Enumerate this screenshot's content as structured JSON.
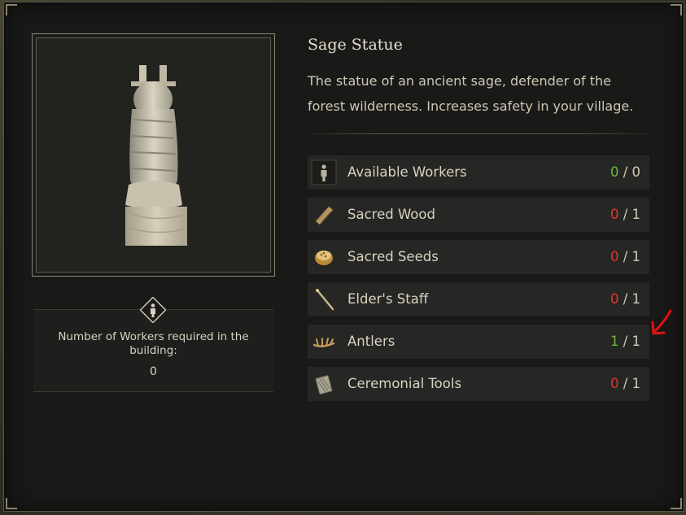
{
  "building": {
    "title": "Sage Statue",
    "description": "The statue of an ancient sage, defender of the forest wilderness. Increases safety in your village."
  },
  "workers_panel": {
    "label": "Number of Workers required in the building:",
    "value": "0",
    "icon": "worker-icon"
  },
  "resources": [
    {
      "name": "Available Workers",
      "have": "0",
      "sep": "/",
      "need": "0",
      "have_status": "ok",
      "icon": "worker-icon"
    },
    {
      "name": "Sacred Wood",
      "have": "0",
      "sep": "/",
      "need": "1",
      "have_status": "zero",
      "icon": "wood-icon"
    },
    {
      "name": "Sacred Seeds",
      "have": "0",
      "sep": "/",
      "need": "1",
      "have_status": "zero",
      "icon": "seeds-icon"
    },
    {
      "name": "Elder's Staff",
      "have": "0",
      "sep": "/",
      "need": "1",
      "have_status": "zero",
      "icon": "staff-icon"
    },
    {
      "name": "Antlers",
      "have": "1",
      "sep": "/",
      "need": "1",
      "have_status": "ok",
      "icon": "antlers-icon"
    },
    {
      "name": "Ceremonial Tools",
      "have": "0",
      "sep": "/",
      "need": "1",
      "have_status": "zero",
      "icon": "tools-icon"
    }
  ],
  "colors": {
    "missing": "#d83a2e",
    "satisfied": "#6cb83c",
    "annotation_arrow": "#e01010"
  }
}
